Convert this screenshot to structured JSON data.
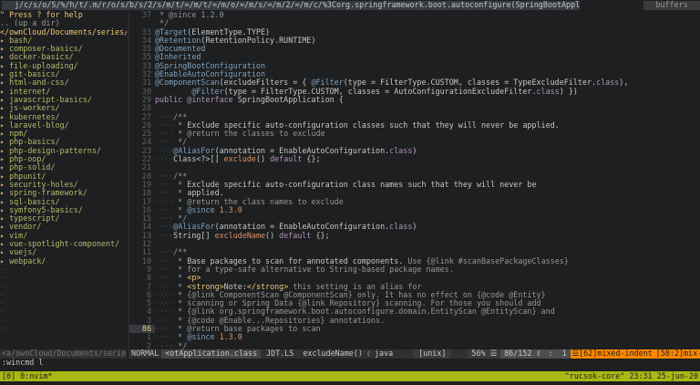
{
  "tabline": {
    "path": "j/c/s/o/S/%/h/t/.m/r/o/s/b/s/2/s/m/t/=/m/t/=/m/o/=/m/s/=/m/2/=/m/c/%3Corg.springframework.boot.autoconfigure(SpringBootApplication.class",
    "buffers": "buffers"
  },
  "sidebar": {
    "help": "\" Press ? for help",
    "updir": ".. (up a dir)",
    "cwd": "</ownCloud/Documents/series/",
    "arrow": "▸",
    "items": [
      "bash/",
      "composer-basics/",
      "docker-basics/",
      "file-uploading/",
      "git-basics/",
      "html-and-css/",
      "internet/",
      "javascript-basics/",
      "js-workers/",
      "kubernetes/",
      "laravel-blog/",
      "npm/",
      "php-basics/",
      "php-design-patterns/",
      "php-oop/",
      "php-solid/",
      "phpunit/",
      "security-holes/",
      "spring-framework/",
      "sql-basics/",
      "symfony5-basics/",
      "typescript/",
      "vendor/",
      "vim/",
      "vue-spotlight-component/",
      "vuejs/",
      "webpack/"
    ],
    "tilde": "~"
  },
  "editor": {
    "lines": [
      {
        "n": "37",
        "t": [
          [
            "cm",
            " * @since 1.2.0"
          ]
        ]
      },
      {
        "n": "",
        "t": [
          [
            "cm",
            " */"
          ]
        ]
      },
      {
        "n": "33",
        "t": [
          [
            "an",
            "@Target"
          ],
          [
            "tx",
            "(ElementType.TYPE)"
          ]
        ]
      },
      {
        "n": "34",
        "t": [
          [
            "an",
            "@Retention"
          ],
          [
            "tx",
            "(RetentionPolicy.RUNTIME)"
          ]
        ]
      },
      {
        "n": "35",
        "t": [
          [
            "an",
            "@Documented"
          ]
        ]
      },
      {
        "n": "35",
        "t": [
          [
            "an",
            "@Inherited"
          ]
        ]
      },
      {
        "n": "33",
        "t": [
          [
            "an",
            "@SpringBootConfiguration"
          ]
        ]
      },
      {
        "n": "32",
        "t": [
          [
            "an",
            "@EnableAutoConfiguration"
          ]
        ]
      },
      {
        "n": "31",
        "t": [
          [
            "an",
            "@ComponentScan"
          ],
          [
            "tx",
            "(excludeFilters = { "
          ],
          [
            "an",
            "@Filter"
          ],
          [
            "tx",
            "(type = FilterType.CUSTOM, classes = TypeExcludeFilter."
          ],
          [
            "kw",
            "class"
          ],
          [
            "tx",
            "),"
          ]
        ]
      },
      {
        "n": "30",
        "t": [
          [
            "tx",
            "        "
          ],
          [
            "an",
            "@Filter"
          ],
          [
            "tx",
            "(type = FilterType.CUSTOM, classes = AutoConfigurationExcludeFilter."
          ],
          [
            "kw",
            "class"
          ],
          [
            "tx",
            ") })"
          ]
        ]
      },
      {
        "n": "29",
        "t": [
          [
            "kw",
            "public @interface "
          ],
          [
            "tx",
            "SpringBootApplication {"
          ]
        ]
      },
      {
        "n": "28",
        "t": [
          [
            "tx",
            ""
          ]
        ]
      },
      {
        "n": "27",
        "t": [
          [
            "dots",
            "····"
          ],
          [
            "cm",
            "/**"
          ]
        ]
      },
      {
        "n": "26",
        "t": [
          [
            "dots",
            "···· "
          ],
          [
            "cm",
            "* "
          ],
          [
            "tx",
            "Exclude specific auto-configuration classes such that they will never be applied."
          ]
        ]
      },
      {
        "n": "25",
        "t": [
          [
            "dots",
            "···· "
          ],
          [
            "cm",
            "* @return the classes to exclude"
          ]
        ]
      },
      {
        "n": "24",
        "t": [
          [
            "dots",
            "···· "
          ],
          [
            "cm",
            "*/"
          ]
        ]
      },
      {
        "n": "23",
        "t": [
          [
            "dots",
            "····"
          ],
          [
            "an",
            "@AliasFor"
          ],
          [
            "tx",
            "(annotation = EnableAutoConfiguration."
          ],
          [
            "kw",
            "class"
          ],
          [
            "tx",
            ")"
          ]
        ]
      },
      {
        "n": "22",
        "t": [
          [
            "dots",
            "····"
          ],
          [
            "tx",
            "Class<?>[] "
          ],
          [
            "cl",
            "exclude"
          ],
          [
            "tx",
            "() "
          ],
          [
            "kw",
            "default"
          ],
          [
            "tx",
            " {};"
          ]
        ]
      },
      {
        "n": "21",
        "t": [
          [
            "tx",
            ""
          ]
        ]
      },
      {
        "n": "20",
        "t": [
          [
            "dots",
            "····"
          ],
          [
            "cm",
            "/**"
          ]
        ]
      },
      {
        "n": "19",
        "t": [
          [
            "dots",
            "···· "
          ],
          [
            "cm",
            "* "
          ],
          [
            "tx",
            "Exclude specific auto-configuration class names such that they will never be"
          ]
        ]
      },
      {
        "n": "18",
        "t": [
          [
            "dots",
            "···· "
          ],
          [
            "cm",
            "* "
          ],
          [
            "tx",
            "applied."
          ]
        ]
      },
      {
        "n": "17",
        "t": [
          [
            "dots",
            "···· "
          ],
          [
            "cm",
            "* @return the class names to exclude"
          ]
        ]
      },
      {
        "n": "16",
        "t": [
          [
            "dots",
            "···· "
          ],
          [
            "cm",
            "* "
          ],
          [
            "an",
            "@since"
          ],
          [
            "cl",
            " 1.3.0"
          ]
        ]
      },
      {
        "n": "15",
        "t": [
          [
            "dots",
            "···· "
          ],
          [
            "cm",
            "*/"
          ]
        ]
      },
      {
        "n": "14",
        "t": [
          [
            "dots",
            "····"
          ],
          [
            "an",
            "@AliasFor"
          ],
          [
            "tx",
            "(annotation = EnableAutoConfiguration."
          ],
          [
            "kw",
            "class"
          ],
          [
            "tx",
            ")"
          ]
        ]
      },
      {
        "n": "13",
        "t": [
          [
            "dots",
            "····"
          ],
          [
            "tx",
            "String[] "
          ],
          [
            "cl",
            "excludeName"
          ],
          [
            "tx",
            "() "
          ],
          [
            "kw",
            "default"
          ],
          [
            "tx",
            " {};"
          ]
        ]
      },
      {
        "n": "12",
        "t": [
          [
            "tx",
            ""
          ]
        ]
      },
      {
        "n": "11",
        "t": [
          [
            "dots",
            "····"
          ],
          [
            "cm",
            "/**"
          ]
        ]
      },
      {
        "n": "10",
        "t": [
          [
            "dots",
            "···· "
          ],
          [
            "cm",
            "* "
          ],
          [
            "tx",
            "Base packages to scan for annotated components. "
          ],
          [
            "cm",
            "Use {@link #scanBasePackageClasses}"
          ]
        ]
      },
      {
        "n": "9",
        "t": [
          [
            "dots",
            "···· "
          ],
          [
            "cm",
            "* for a type-safe alternative to String-based package names."
          ]
        ]
      },
      {
        "n": "8",
        "t": [
          [
            "dots",
            "···· "
          ],
          [
            "cm",
            "* "
          ],
          [
            "tg",
            "<p>"
          ]
        ]
      },
      {
        "n": "7",
        "t": [
          [
            "dots",
            "···· "
          ],
          [
            "cm",
            "* "
          ],
          [
            "tg",
            "<strong>"
          ],
          [
            "tx",
            "Note:"
          ],
          [
            "tg",
            "</strong>"
          ],
          [
            "cm",
            " this setting is an alias for"
          ]
        ]
      },
      {
        "n": "6",
        "t": [
          [
            "dots",
            "···· "
          ],
          [
            "cm",
            "* {@link ComponentScan @ComponentScan} only. It has no effect on {@code @Entity}"
          ]
        ]
      },
      {
        "n": "5",
        "t": [
          [
            "dots",
            "···· "
          ],
          [
            "cm",
            "* scanning or Spring Data {@link Repository} scanning. For those you should add"
          ]
        ]
      },
      {
        "n": "4",
        "t": [
          [
            "dots",
            "···· "
          ],
          [
            "cm",
            "* {@link org.springframework.boot.autoconfigure.domain.EntityScan @EntityScan} and"
          ]
        ]
      },
      {
        "n": "3",
        "t": [
          [
            "dots",
            "···· "
          ],
          [
            "cm",
            "* {@code @Enable...Repositories} annotations."
          ]
        ]
      },
      {
        "n": "86",
        "cur": true,
        "t": [
          [
            "dots",
            "···· "
          ],
          [
            "cm",
            "* @return base packages to scan"
          ]
        ]
      },
      {
        "n": "1",
        "t": [
          [
            "dots",
            "···· "
          ],
          [
            "cm",
            "* "
          ],
          [
            "an",
            "@since"
          ],
          [
            "cl",
            " 1.3.0"
          ]
        ]
      },
      {
        "n": "2",
        "t": [
          [
            "dots",
            "···· "
          ],
          [
            "cm",
            "*/"
          ]
        ]
      }
    ]
  },
  "statusline": {
    "left": "<a/ownCloud/Documents/series",
    "mode": "NORMAL",
    "file": "<otApplication.class",
    "filetype": "JDT.LS",
    "function": "excludeName()",
    "sep": "❮",
    "lang": "java",
    "fileformat": "[unix]",
    "percent": "56% ☰",
    "position": "86/152 ℓ",
    "column": ":  1",
    "warn_indent": "☰[62]mixed-indent",
    "warn_file": "[58:2]mix-indent-file"
  },
  "cmdline": ":wincmd l",
  "tmux": {
    "left": "[0] 0:nvim*",
    "right": "\"rucsok-core\" 23:31 25-jun-20"
  }
}
